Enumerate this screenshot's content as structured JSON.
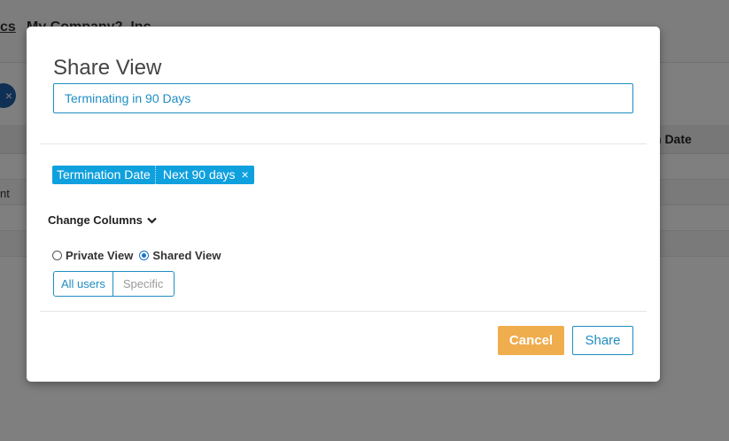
{
  "background": {
    "nav_partial_a": "cs",
    "nav_partial_b": "My Company2, Inc",
    "column_header_partial": "n Date",
    "row_text_partial": "nt",
    "chip_close": "×"
  },
  "modal": {
    "title": "Share View",
    "view_name": "Terminating in 90 Days",
    "filter": {
      "field": "Termination Date",
      "value": "Next 90 days",
      "close": "×"
    },
    "change_columns_label": "Change Columns",
    "visibility": {
      "options": [
        "Private View",
        "Shared View"
      ],
      "selected": "Shared View"
    },
    "audience": {
      "options": [
        "All users",
        "Specific"
      ],
      "selected": "All users"
    },
    "cancel_label": "Cancel",
    "share_label": "Share"
  },
  "colors": {
    "accent": "#1f8dc2",
    "chip": "#0fa0de",
    "cancel": "#f0ad4e"
  }
}
